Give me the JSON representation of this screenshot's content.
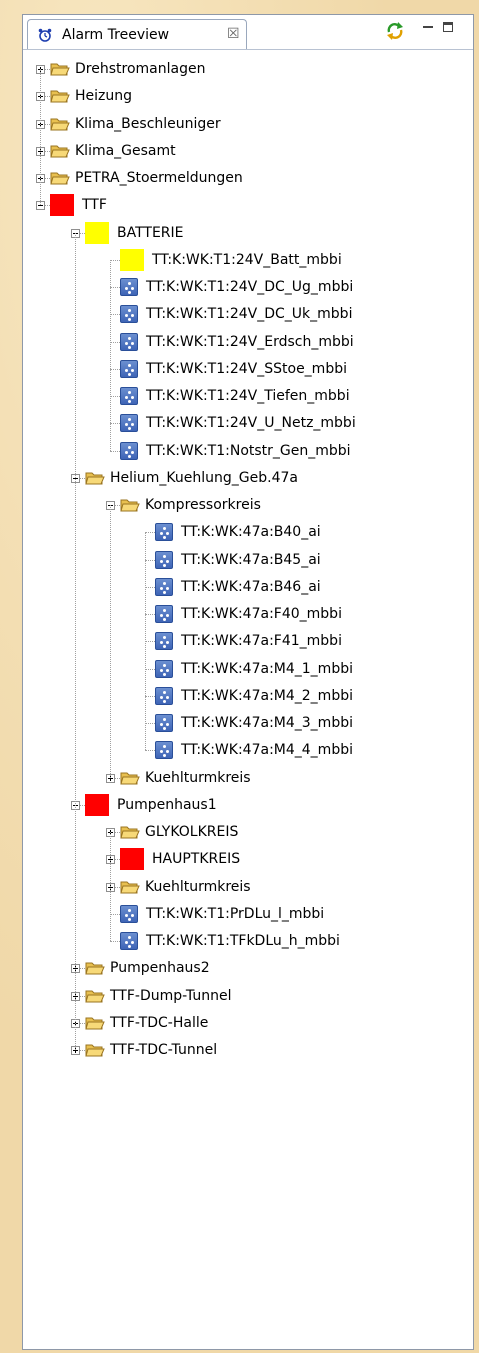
{
  "view": {
    "title": "Alarm Treeview",
    "close_glyph": "☒",
    "icons": {
      "tab": "alarm-clock-icon",
      "sync": "sync-arrows-icon",
      "minimize": "minimize-icon",
      "maximize": "maximize-icon"
    }
  },
  "colors": {
    "alarm_red": "#ff0000",
    "alarm_yellow": "#ffff00",
    "folder": "#f0c040",
    "pv_blue": "#3e64b6",
    "background": "#f0d8a8"
  },
  "tree": [
    {
      "label": "Drehstromanlagen",
      "level": 0,
      "type": "folder",
      "expander": "plus"
    },
    {
      "label": "Heizung",
      "level": 0,
      "type": "folder",
      "expander": "plus"
    },
    {
      "label": "Klima_Beschleuniger",
      "level": 0,
      "type": "folder",
      "expander": "plus"
    },
    {
      "label": "Klima_Gesamt",
      "level": 0,
      "type": "folder",
      "expander": "plus"
    },
    {
      "label": "PETRA_Stoermeldungen",
      "level": 0,
      "type": "folder",
      "expander": "plus"
    },
    {
      "label": "TTF",
      "level": 0,
      "type": "red",
      "expander": "minus"
    },
    {
      "label": "BATTERIE",
      "level": 1,
      "type": "yellow",
      "expander": "minus"
    },
    {
      "label": "TT:K:WK:T1:24V_Batt_mbbi",
      "level": 2,
      "type": "yellow",
      "expander": "none"
    },
    {
      "label": "TT:K:WK:T1:24V_DC_Ug_mbbi",
      "level": 2,
      "type": "pv",
      "expander": "none"
    },
    {
      "label": "TT:K:WK:T1:24V_DC_Uk_mbbi",
      "level": 2,
      "type": "pv",
      "expander": "none"
    },
    {
      "label": "TT:K:WK:T1:24V_Erdsch_mbbi",
      "level": 2,
      "type": "pv",
      "expander": "none"
    },
    {
      "label": "TT:K:WK:T1:24V_SStoe_mbbi",
      "level": 2,
      "type": "pv",
      "expander": "none"
    },
    {
      "label": "TT:K:WK:T1:24V_Tiefen_mbbi",
      "level": 2,
      "type": "pv",
      "expander": "none"
    },
    {
      "label": "TT:K:WK:T1:24V_U_Netz_mbbi",
      "level": 2,
      "type": "pv",
      "expander": "none"
    },
    {
      "label": "TT:K:WK:T1:Notstr_Gen_mbbi",
      "level": 2,
      "type": "pv",
      "expander": "none"
    },
    {
      "label": "Helium_Kuehlung_Geb.47a",
      "level": 1,
      "type": "folder",
      "expander": "minus"
    },
    {
      "label": "Kompressorkreis",
      "level": 2,
      "type": "folder",
      "expander": "minus"
    },
    {
      "label": "TT:K:WK:47a:B40_ai",
      "level": 3,
      "type": "pv",
      "expander": "none"
    },
    {
      "label": "TT:K:WK:47a:B45_ai",
      "level": 3,
      "type": "pv",
      "expander": "none"
    },
    {
      "label": "TT:K:WK:47a:B46_ai",
      "level": 3,
      "type": "pv",
      "expander": "none"
    },
    {
      "label": "TT:K:WK:47a:F40_mbbi",
      "level": 3,
      "type": "pv",
      "expander": "none"
    },
    {
      "label": "TT:K:WK:47a:F41_mbbi",
      "level": 3,
      "type": "pv",
      "expander": "none"
    },
    {
      "label": "TT:K:WK:47a:M4_1_mbbi",
      "level": 3,
      "type": "pv",
      "expander": "none"
    },
    {
      "label": "TT:K:WK:47a:M4_2_mbbi",
      "level": 3,
      "type": "pv",
      "expander": "none"
    },
    {
      "label": "TT:K:WK:47a:M4_3_mbbi",
      "level": 3,
      "type": "pv",
      "expander": "none"
    },
    {
      "label": "TT:K:WK:47a:M4_4_mbbi",
      "level": 3,
      "type": "pv",
      "expander": "none"
    },
    {
      "label": "Kuehlturmkreis",
      "level": 2,
      "type": "folder",
      "expander": "plus"
    },
    {
      "label": "Pumpenhaus1",
      "level": 1,
      "type": "red",
      "expander": "minus"
    },
    {
      "label": "GLYKOLKREIS",
      "level": 2,
      "type": "folder",
      "expander": "plus"
    },
    {
      "label": "HAUPTKREIS",
      "level": 2,
      "type": "red",
      "expander": "plus"
    },
    {
      "label": "Kuehlturmkreis",
      "level": 2,
      "type": "folder",
      "expander": "plus"
    },
    {
      "label": "TT:K:WK:T1:PrDLu_l_mbbi",
      "level": 2,
      "type": "pv",
      "expander": "none"
    },
    {
      "label": "TT:K:WK:T1:TFkDLu_h_mbbi",
      "level": 2,
      "type": "pv",
      "expander": "none"
    },
    {
      "label": "Pumpenhaus2",
      "level": 1,
      "type": "folder",
      "expander": "plus"
    },
    {
      "label": "TTF-Dump-Tunnel",
      "level": 1,
      "type": "folder",
      "expander": "plus"
    },
    {
      "label": "TTF-TDC-Halle",
      "level": 1,
      "type": "folder",
      "expander": "plus"
    },
    {
      "label": "TTF-TDC-Tunnel",
      "level": 1,
      "type": "folder",
      "expander": "plus"
    }
  ]
}
